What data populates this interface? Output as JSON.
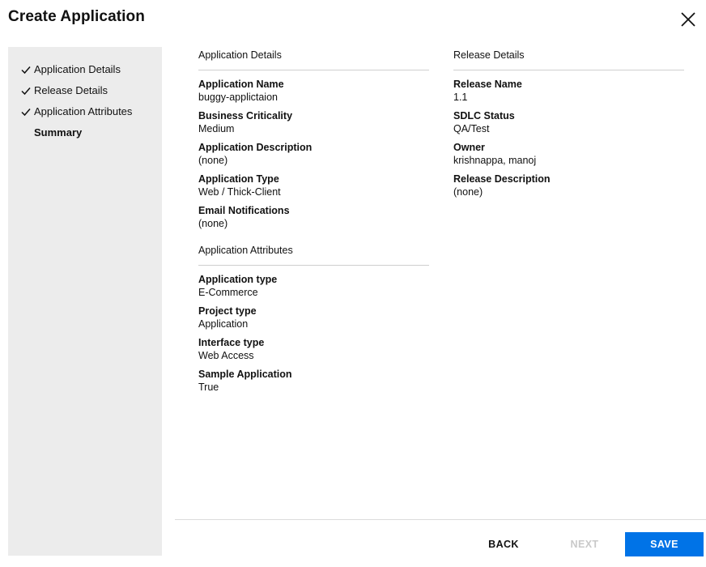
{
  "dialog": {
    "title": "Create Application",
    "close_icon": "close-icon"
  },
  "sidebar": {
    "steps": [
      {
        "label": "Application Details",
        "completed": true
      },
      {
        "label": "Release Details",
        "completed": true
      },
      {
        "label": "Application Attributes",
        "completed": true
      },
      {
        "label": "Summary",
        "completed": false,
        "current": true
      }
    ]
  },
  "application_details": {
    "header": "Application Details",
    "fields": [
      {
        "label": "Application Name",
        "value": "buggy-applictaion"
      },
      {
        "label": "Business Criticality",
        "value": "Medium"
      },
      {
        "label": "Application Description",
        "value": "(none)"
      },
      {
        "label": "Application Type",
        "value": "Web / Thick-Client"
      },
      {
        "label": "Email Notifications",
        "value": "(none)"
      }
    ]
  },
  "application_attributes": {
    "header": "Application Attributes",
    "fields": [
      {
        "label": "Application type",
        "value": "E-Commerce"
      },
      {
        "label": "Project type",
        "value": "Application"
      },
      {
        "label": "Interface type",
        "value": "Web Access"
      },
      {
        "label": "Sample Application",
        "value": "True"
      }
    ]
  },
  "release_details": {
    "header": "Release Details",
    "fields": [
      {
        "label": "Release Name",
        "value": "1.1"
      },
      {
        "label": "SDLC Status",
        "value": "QA/Test"
      },
      {
        "label": "Owner",
        "value": "krishnappa, manoj"
      },
      {
        "label": "Release Description",
        "value": "(none)"
      }
    ]
  },
  "footer": {
    "back_label": "BACK",
    "next_label": "NEXT",
    "save_label": "SAVE"
  },
  "colors": {
    "primary": "#0073e7",
    "sidebar_bg": "#ececec",
    "disabled_text": "#c9c9c9"
  }
}
